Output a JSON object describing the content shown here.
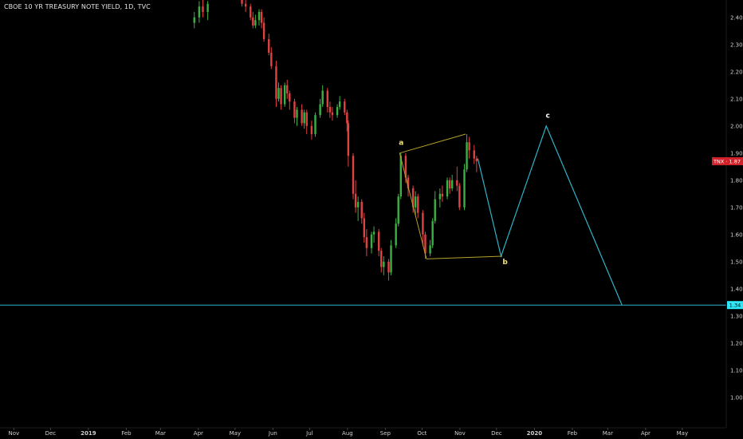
{
  "header": {
    "title": "CBOE 10 YR TREASURY NOTE YIELD, 1D, TVC"
  },
  "colors": {
    "background": "#000000",
    "up": "#3bb143",
    "down": "#e04242",
    "wave": "#2fb3c8",
    "channel": "#b5a12a",
    "price_tag": "#d0222a",
    "level_tag": "#2ee6f5",
    "wave_label": "#ffffff",
    "channel_label": "#f2e177"
  },
  "chart_data": {
    "type": "candlestick",
    "y_axis": {
      "ticks": [
        "2.40",
        "2.30",
        "2.20",
        "2.10",
        "2.00",
        "1.90",
        "1.80",
        "1.70",
        "1.60",
        "1.50",
        "1.40",
        "1.30",
        "1.20",
        "1.10",
        "1.00"
      ],
      "ylim": [
        0.95,
        2.47
      ]
    },
    "x_axis": {
      "ticks": [
        "Nov",
        "Dec",
        "2019",
        "Feb",
        "Mar",
        "Apr",
        "May",
        "Jun",
        "Jul",
        "Aug",
        "Sep",
        "Oct",
        "Nov",
        "Dec",
        "2020",
        "Feb",
        "Mar",
        "Apr",
        "May"
      ],
      "xlim": [
        "2018-10-20",
        "2020-05-25"
      ]
    },
    "series": [
      {
        "type": "candles",
        "ohlc": [
          [
            "2019-03-28",
            2.38,
            2.42,
            2.36,
            2.4
          ],
          [
            "2019-04-01",
            2.4,
            2.46,
            2.38,
            2.44
          ],
          [
            "2019-04-04",
            2.44,
            2.47,
            2.4,
            2.42
          ],
          [
            "2019-04-08",
            2.42,
            2.46,
            2.39,
            2.45
          ],
          [
            "2019-05-06",
            2.47,
            2.48,
            2.44,
            2.45
          ],
          [
            "2019-05-09",
            2.45,
            2.47,
            2.42,
            2.44
          ],
          [
            "2019-05-13",
            2.44,
            2.45,
            2.39,
            2.4
          ],
          [
            "2019-05-15",
            2.4,
            2.42,
            2.36,
            2.37
          ],
          [
            "2019-05-17",
            2.37,
            2.41,
            2.36,
            2.39
          ],
          [
            "2019-05-20",
            2.39,
            2.43,
            2.37,
            2.42
          ],
          [
            "2019-05-22",
            2.42,
            2.43,
            2.36,
            2.38
          ],
          [
            "2019-05-24",
            2.38,
            2.4,
            2.31,
            2.32
          ],
          [
            "2019-05-28",
            2.32,
            2.34,
            2.26,
            2.27
          ],
          [
            "2019-05-30",
            2.27,
            2.29,
            2.21,
            2.22
          ],
          [
            "2019-06-03",
            2.22,
            2.24,
            2.07,
            2.1
          ],
          [
            "2019-06-05",
            2.1,
            2.16,
            2.09,
            2.14
          ],
          [
            "2019-06-07",
            2.14,
            2.15,
            2.06,
            2.08
          ],
          [
            "2019-06-10",
            2.08,
            2.16,
            2.07,
            2.15
          ],
          [
            "2019-06-12",
            2.15,
            2.17,
            2.1,
            2.12
          ],
          [
            "2019-06-14",
            2.12,
            2.13,
            2.06,
            2.09
          ],
          [
            "2019-06-18",
            2.09,
            2.1,
            2.01,
            2.03
          ],
          [
            "2019-06-20",
            2.03,
            2.07,
            2.0,
            2.06
          ],
          [
            "2019-06-24",
            2.06,
            2.08,
            2.0,
            2.01
          ],
          [
            "2019-06-26",
            2.01,
            2.06,
            1.99,
            2.05
          ],
          [
            "2019-06-28",
            2.05,
            2.06,
            1.97,
            2.0
          ],
          [
            "2019-07-02",
            2.0,
            2.02,
            1.95,
            1.97
          ],
          [
            "2019-07-05",
            1.97,
            2.05,
            1.96,
            2.04
          ],
          [
            "2019-07-09",
            2.04,
            2.1,
            2.03,
            2.08
          ],
          [
            "2019-07-11",
            2.08,
            2.15,
            2.07,
            2.13
          ],
          [
            "2019-07-15",
            2.13,
            2.14,
            2.05,
            2.07
          ],
          [
            "2019-07-17",
            2.07,
            2.09,
            2.03,
            2.05
          ],
          [
            "2019-07-19",
            2.05,
            2.07,
            2.02,
            2.04
          ],
          [
            "2019-07-23",
            2.04,
            2.08,
            2.03,
            2.07
          ],
          [
            "2019-07-25",
            2.07,
            2.11,
            2.06,
            2.09
          ],
          [
            "2019-07-29",
            2.09,
            2.1,
            2.04,
            2.05
          ],
          [
            "2019-07-31",
            2.05,
            2.06,
            1.98,
            2.01
          ],
          [
            "2019-08-01",
            2.01,
            2.02,
            1.85,
            1.89
          ],
          [
            "2019-08-05",
            1.89,
            1.9,
            1.73,
            1.75
          ],
          [
            "2019-08-07",
            1.75,
            1.8,
            1.68,
            1.7
          ],
          [
            "2019-08-09",
            1.7,
            1.74,
            1.65,
            1.72
          ],
          [
            "2019-08-12",
            1.72,
            1.73,
            1.64,
            1.66
          ],
          [
            "2019-08-14",
            1.66,
            1.68,
            1.57,
            1.59
          ],
          [
            "2019-08-16",
            1.59,
            1.62,
            1.52,
            1.55
          ],
          [
            "2019-08-20",
            1.55,
            1.61,
            1.53,
            1.6
          ],
          [
            "2019-08-22",
            1.6,
            1.63,
            1.57,
            1.61
          ],
          [
            "2019-08-26",
            1.61,
            1.62,
            1.52,
            1.54
          ],
          [
            "2019-08-28",
            1.54,
            1.55,
            1.46,
            1.48
          ],
          [
            "2019-08-30",
            1.48,
            1.52,
            1.45,
            1.5
          ],
          [
            "2019-09-03",
            1.5,
            1.51,
            1.43,
            1.46
          ],
          [
            "2019-09-05",
            1.46,
            1.58,
            1.45,
            1.56
          ],
          [
            "2019-09-09",
            1.56,
            1.66,
            1.55,
            1.64
          ],
          [
            "2019-09-11",
            1.64,
            1.75,
            1.63,
            1.74
          ],
          [
            "2019-09-13",
            1.74,
            1.9,
            1.73,
            1.89
          ],
          [
            "2019-09-17",
            1.89,
            1.9,
            1.79,
            1.81
          ],
          [
            "2019-09-19",
            1.81,
            1.82,
            1.74,
            1.77
          ],
          [
            "2019-09-23",
            1.77,
            1.78,
            1.68,
            1.7
          ],
          [
            "2019-09-25",
            1.7,
            1.76,
            1.67,
            1.74
          ],
          [
            "2019-09-27",
            1.74,
            1.75,
            1.66,
            1.68
          ],
          [
            "2019-10-01",
            1.68,
            1.69,
            1.56,
            1.6
          ],
          [
            "2019-10-03",
            1.6,
            1.61,
            1.51,
            1.53
          ],
          [
            "2019-10-07",
            1.53,
            1.58,
            1.52,
            1.56
          ],
          [
            "2019-10-09",
            1.56,
            1.66,
            1.55,
            1.65
          ],
          [
            "2019-10-11",
            1.65,
            1.76,
            1.64,
            1.73
          ],
          [
            "2019-10-15",
            1.73,
            1.77,
            1.7,
            1.75
          ],
          [
            "2019-10-17",
            1.75,
            1.78,
            1.72,
            1.74
          ],
          [
            "2019-10-21",
            1.74,
            1.81,
            1.73,
            1.8
          ],
          [
            "2019-10-23",
            1.8,
            1.81,
            1.75,
            1.77
          ],
          [
            "2019-10-25",
            1.77,
            1.82,
            1.76,
            1.8
          ],
          [
            "2019-10-29",
            1.8,
            1.85,
            1.76,
            1.78
          ],
          [
            "2019-10-31",
            1.78,
            1.79,
            1.69,
            1.7
          ],
          [
            "2019-11-04",
            1.7,
            1.86,
            1.69,
            1.84
          ],
          [
            "2019-11-06",
            1.84,
            1.97,
            1.83,
            1.94
          ],
          [
            "2019-11-08",
            1.94,
            1.96,
            1.88,
            1.91
          ],
          [
            "2019-11-12",
            1.91,
            1.93,
            1.86,
            1.88
          ],
          [
            "2019-11-14",
            1.88,
            1.89,
            1.83,
            1.87
          ]
        ]
      },
      {
        "name": "",
        "type": "line",
        "role": "wave-projection",
        "points": [
          [
            "2019-11-15",
            1.88
          ],
          [
            "2019-12-04",
            1.52
          ],
          [
            "2020-01-10",
            2.0
          ],
          [
            "2020-03-12",
            1.34
          ]
        ]
      },
      {
        "name": "",
        "type": "line",
        "role": "channel-upper",
        "points": [
          [
            "2019-09-12",
            1.9
          ],
          [
            "2019-11-05",
            1.97
          ]
        ]
      },
      {
        "name": "",
        "type": "line",
        "role": "channel-lower",
        "points": [
          [
            "2019-10-04",
            1.51
          ],
          [
            "2019-12-05",
            1.52
          ]
        ]
      },
      {
        "name": "",
        "type": "line",
        "role": "channel-left",
        "points": [
          [
            "2019-09-12",
            1.9
          ],
          [
            "2019-10-04",
            1.51
          ]
        ]
      },
      {
        "name": "",
        "type": "hline",
        "role": "support-level",
        "value": 1.34
      }
    ],
    "annotations": [
      {
        "text": "a",
        "date": "2019-09-12",
        "value": 1.93,
        "style": "channel"
      },
      {
        "text": "b",
        "date": "2019-12-06",
        "value": 1.49,
        "style": "channel"
      },
      {
        "text": "c",
        "date": "2020-01-10",
        "value": 2.03,
        "style": "wave"
      }
    ],
    "price_tag": {
      "text": "TNX · 1.87",
      "value": 1.87
    },
    "level_tag": {
      "text": "1.34",
      "value": 1.34
    },
    "grid": false,
    "legend": "none"
  }
}
